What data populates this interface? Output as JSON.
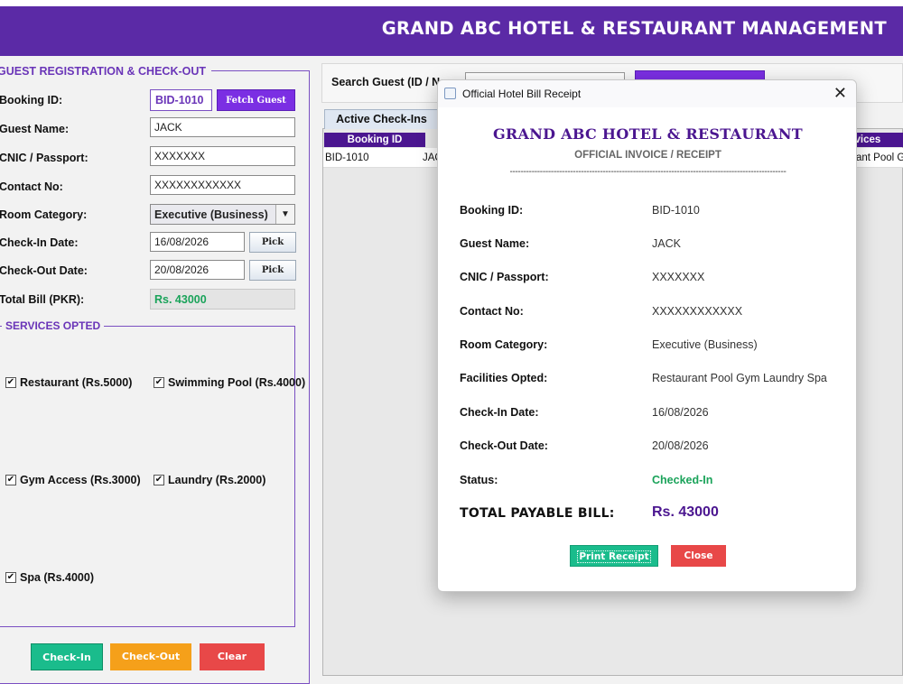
{
  "header": {
    "title": "GRAND ABC HOTEL & RESTAURANT MANAGEMENT"
  },
  "registration": {
    "section_title": "GUEST REGISTRATION & CHECK-OUT",
    "booking_id_label": "Booking ID:",
    "booking_id_value": "BID-1010",
    "fetch_button": "Fetch Guest",
    "guest_name_label": "Guest Name:",
    "guest_name_value": "JACK",
    "cnic_label": "CNIC / Passport:",
    "cnic_value": "XXXXXXX",
    "contact_label": "Contact No:",
    "contact_value": "XXXXXXXXXXXX",
    "room_category_label": "Room Category:",
    "room_category_value": "Executive (Business)",
    "checkin_label": "Check-In Date:",
    "checkin_value": "16/08/2026",
    "checkout_label": "Check-Out Date:",
    "checkout_value": "20/08/2026",
    "pick_button": "Pick",
    "total_label": "Total Bill (PKR):",
    "total_value": "Rs. 43000"
  },
  "services": {
    "title": "SERVICES OPTED",
    "items": [
      {
        "label": "Restaurant (Rs.5000)",
        "checked": true
      },
      {
        "label": "Swimming Pool (Rs.4000)",
        "checked": true
      },
      {
        "label": "Gym Access (Rs.3000)",
        "checked": true
      },
      {
        "label": "Laundry (Rs.2000)",
        "checked": true
      },
      {
        "label": "Spa (Rs.4000)",
        "checked": true
      }
    ],
    "check_mark": "✔"
  },
  "actions": {
    "checkin": "Check-In",
    "checkout": "Check-Out",
    "clear": "Clear"
  },
  "search": {
    "label": "Search Guest (ID / Nar"
  },
  "tabs": {
    "active": "Active Check-Ins"
  },
  "table": {
    "headers": {
      "booking_id": "Booking ID",
      "services": "rvices"
    },
    "row": {
      "booking_id": "BID-1010",
      "name_partial": "JAC",
      "services_partial": "ant Pool Gy"
    }
  },
  "dialog": {
    "window_title": "Official Hotel Bill Receipt",
    "close_glyph": "✕",
    "hotel_name": "GRAND ABC HOTEL & RESTAURANT",
    "subtitle": "OFFICIAL INVOICE / RECEIPT",
    "divider": "-----------------------------------------------------------------------------------------------------",
    "fields": [
      {
        "label": "Booking ID:",
        "value": "BID-1010"
      },
      {
        "label": "Guest Name:",
        "value": "JACK"
      },
      {
        "label": "CNIC / Passport:",
        "value": "XXXXXXX"
      },
      {
        "label": "Contact No:",
        "value": "XXXXXXXXXXXX"
      },
      {
        "label": "Room Category:",
        "value": "Executive (Business)"
      },
      {
        "label": "Facilities Opted:",
        "value": "Restaurant Pool Gym Laundry Spa"
      },
      {
        "label": "Check-In Date:",
        "value": "16/08/2026"
      },
      {
        "label": "Check-Out Date:",
        "value": "20/08/2026"
      },
      {
        "label": "Status:",
        "value": "Checked-In"
      }
    ],
    "total_label": "TOTAL PAYABLE BILL:",
    "total_value": "Rs. 43000",
    "print_button": "Print Receipt",
    "close_button": "Close"
  },
  "colors": {
    "brand_purple": "#5b2aa6",
    "accent_purple": "#7b2fe3",
    "green": "#1abc8c",
    "orange": "#f5a01a",
    "red": "#e84848"
  }
}
